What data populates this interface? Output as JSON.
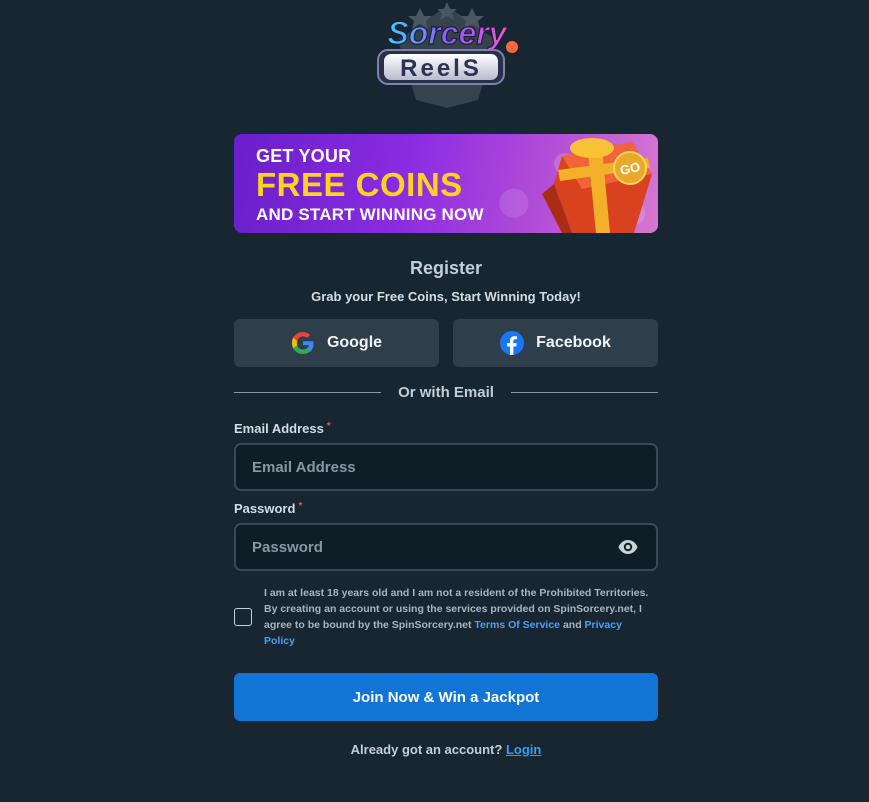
{
  "brand": {
    "logo_top": "Sorcery",
    "logo_bottom": "ReelS",
    "colors": {
      "primary_button": "#1274d4",
      "background": "#172630",
      "link": "#3a9bf0"
    }
  },
  "banner": {
    "line1": "GET YOUR",
    "line2": "FREE COINS",
    "line3": "AND START WINNING NOW",
    "badge": "GO"
  },
  "register": {
    "title": "Register",
    "subtitle": "Grab your Free Coins, Start Winning Today!"
  },
  "social": {
    "google_label": "Google",
    "google_icon": "google-icon",
    "facebook_label": "Facebook",
    "facebook_icon": "facebook-icon"
  },
  "divider_text": "Or with Email",
  "form": {
    "email_label": "Email Address",
    "email_required": "*",
    "email_placeholder": "Email Address",
    "password_label": "Password",
    "password_required": "*",
    "password_placeholder": "Password",
    "terms_text": "I am at least 18 years old and I am not a resident of the Prohibited Territories. By creating an account or using the services provided on SpinSorcery.net, I agree to be bound by the SpinSorcery.net ",
    "terms_link": "Terms Of Service",
    "terms_and": " and ",
    "privacy_link": "Privacy Policy",
    "submit_label": "Join Now & Win a Jackpot"
  },
  "footer": {
    "question": "Already got an account? ",
    "login_link": "Login"
  }
}
